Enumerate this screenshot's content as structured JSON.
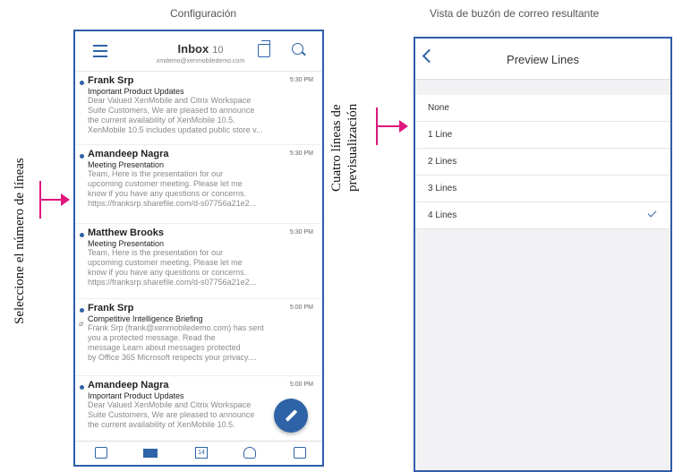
{
  "captions": {
    "left": "Configuración",
    "right": "Vista de buzón de correo resultante"
  },
  "side_labels": {
    "left": "Seleccione el número de líneas",
    "right": "Cuatro líneas de previsualización"
  },
  "colors": {
    "accent": "#2f63a8",
    "arrow": "#e0167d"
  },
  "inbox": {
    "title": "Inbox",
    "count": "10",
    "account": "xmdemo@xenmobiledemo.com",
    "messages": [
      {
        "from": "Frank Srp",
        "time": "5:30 PM",
        "subject": "Important Product Updates",
        "preview": "Dear Valued XenMobile and Citrix Workspace\nSuite Customers,     We are pleased to announce\nthe current availability of XenMobile 10.5.\nXenMobile 10.5 includes updated public store v...",
        "attachment": false
      },
      {
        "from": "Amandeep Nagra",
        "time": "5:30 PM",
        "subject": "Meeting Presentation",
        "preview": "Team,    Here is the presentation for our\nupcoming customer meeting.  Please let me\nknow if you have any questions or concerns.\nhttps://franksrp.sharefile.com/d-s07756a21e2...",
        "attachment": false
      },
      {
        "from": "Matthew Brooks",
        "time": "5:30 PM",
        "subject": "Meeting Presentation",
        "preview": "Team,    Here is the presentation for our\nupcoming customer meeting.  Please let me\nknow if you have any questions or concerns.\nhttps://franksrp.sharefile.com/d-s07756a21e2...",
        "attachment": false
      },
      {
        "from": "Frank Srp",
        "time": "5:00 PM",
        "subject": "Competitive Intelligence Briefing",
        "preview": "Frank Srp (frank@xenmobiledemo.com) has sent\nyou a protected message.        Read the\nmessage        Learn about messages protected\nby Office 365  Microsoft respects your privacy....",
        "attachment": true
      },
      {
        "from": "Amandeep Nagra",
        "time": "5:00 PM",
        "subject": "Important Product Updates",
        "preview": "Dear Valued XenMobile and Citrix Workspace\nSuite Customers,     We are pleased to announce\nthe current availability of XenMobile 10.5.",
        "attachment": false
      }
    ],
    "tab_calendar_day": "14"
  },
  "preview_lines": {
    "title": "Preview Lines",
    "options": [
      "None",
      "1 Line",
      "2 Lines",
      "3 Lines",
      "4 Lines"
    ],
    "selected": "4 Lines"
  }
}
